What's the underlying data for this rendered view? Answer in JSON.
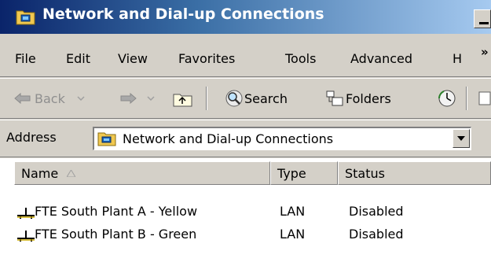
{
  "window": {
    "title": "Network and Dial-up Connections",
    "title_bar_color_start": "#0a246a",
    "title_bar_color_end": "#a6caf0"
  },
  "menubar": {
    "items": [
      {
        "label": "File"
      },
      {
        "label": "Edit"
      },
      {
        "label": "View"
      },
      {
        "label": "Favorites"
      },
      {
        "label": "Tools"
      },
      {
        "label": "Advanced"
      },
      {
        "label": "H"
      }
    ],
    "overflow_label": "»"
  },
  "toolbar": {
    "back_label": "Back",
    "search_label": "Search",
    "folders_label": "Folders",
    "icons": [
      "back-arrow-icon",
      "forward-arrow-icon",
      "up-folder-icon",
      "search-icon",
      "folders-icon",
      "history-icon"
    ]
  },
  "address": {
    "label": "Address",
    "value": "Network and Dial-up Connections"
  },
  "list": {
    "columns": [
      {
        "label": "Name",
        "sorted": true
      },
      {
        "label": "Type"
      },
      {
        "label": "Status"
      }
    ],
    "rows": [
      {
        "name": "FTE South Plant A - Yellow",
        "type": "LAN",
        "status": "Disabled"
      },
      {
        "name": "FTE South Plant B - Green",
        "type": "LAN",
        "status": "Disabled"
      }
    ]
  }
}
